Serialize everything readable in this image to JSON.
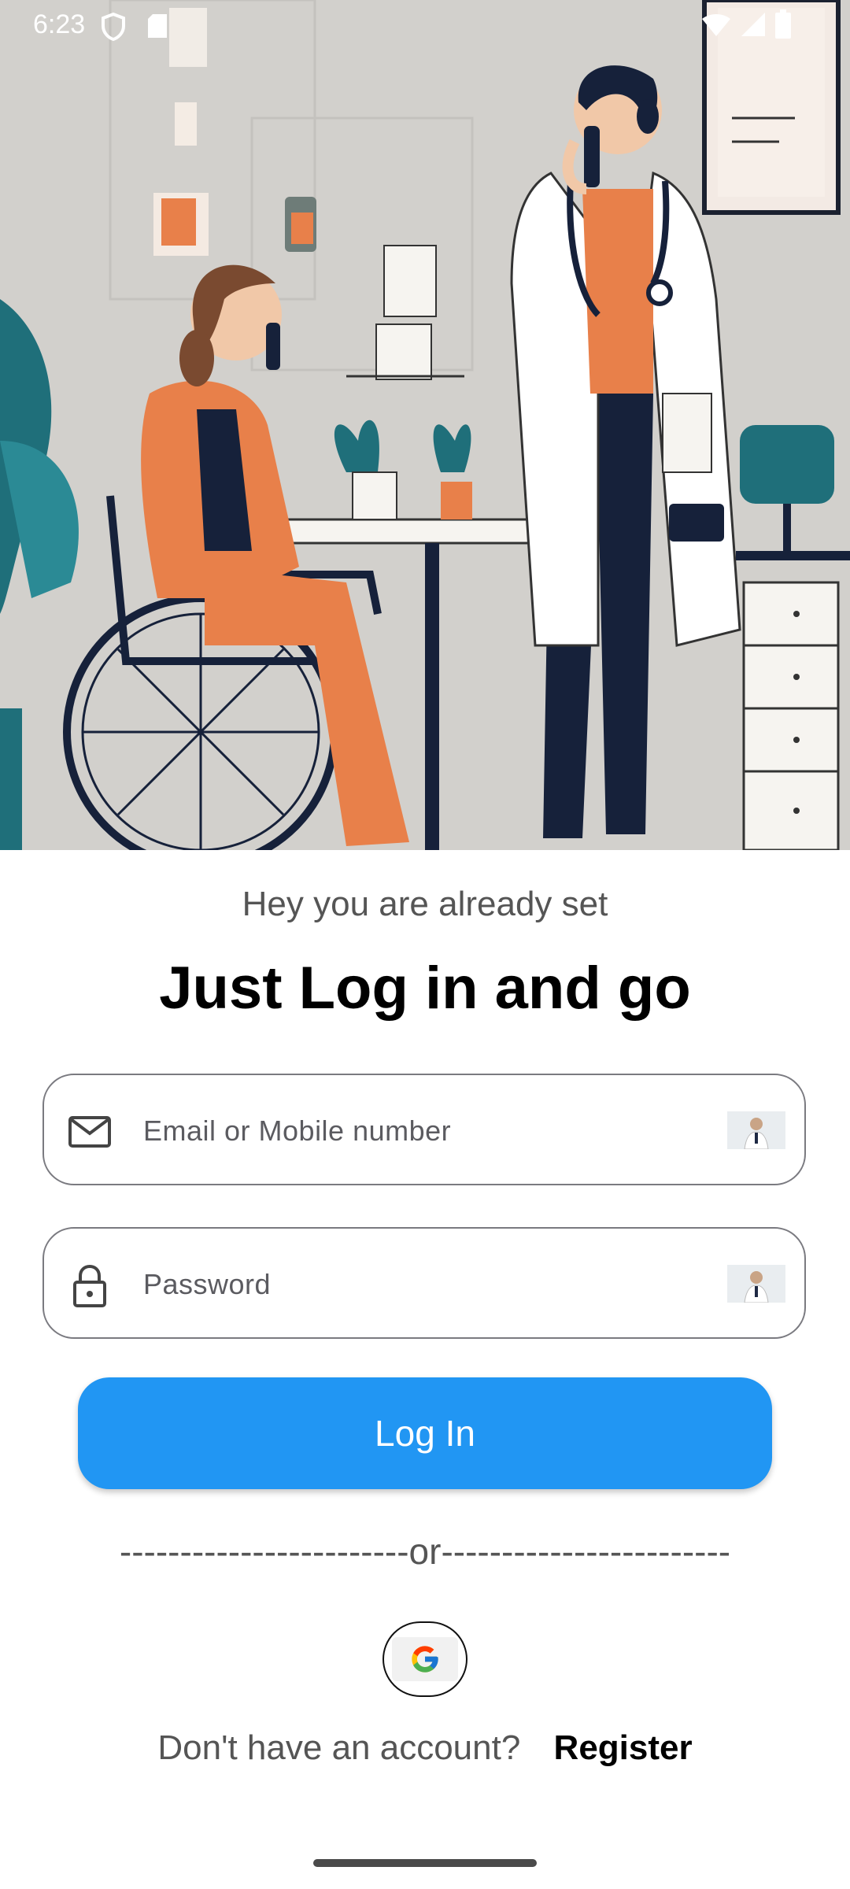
{
  "status_bar": {
    "time": "6:23",
    "icons": [
      "shield-icon",
      "sd-card-icon",
      "wifi-icon",
      "signal-icon",
      "battery-icon"
    ]
  },
  "hero": {
    "illustration": "doctor-and-patient-in-wheelchair-illustration",
    "colors": {
      "background": "#d2d0cc",
      "orange": "#e8804a",
      "navy": "#16213a",
      "teal": "#1f6f7a",
      "coat": "#ffffff"
    }
  },
  "login": {
    "subtitle": "Hey you are already set",
    "title": "Just Log in and go",
    "email": {
      "placeholder": "Email or Mobile number",
      "value": "",
      "leading_icon": "mail-icon",
      "trailing_image": "doctor-thumbnail"
    },
    "password": {
      "placeholder": "Password",
      "value": "",
      "leading_icon": "lock-icon",
      "trailing_image": "doctor-thumbnail"
    },
    "login_button": "Log In",
    "divider": "------------------------or------------------------",
    "google_icon": "google-icon",
    "register_prompt": "Don't have an account?",
    "register_link": "Register"
  },
  "theme": {
    "accent": "#2196f3",
    "text_muted": "#555555"
  }
}
